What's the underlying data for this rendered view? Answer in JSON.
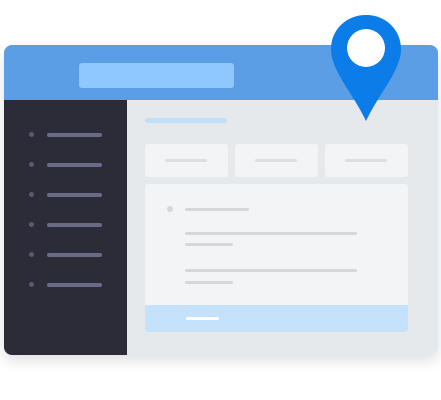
{
  "search": {
    "value": "",
    "placeholder": ""
  },
  "icons": {
    "search": "search-icon",
    "location_pin": "map-pin-icon"
  },
  "sidebar": {
    "items": [
      {
        "id": 1
      },
      {
        "id": 2
      },
      {
        "id": 3
      },
      {
        "id": 4
      },
      {
        "id": 5
      },
      {
        "id": 6
      }
    ]
  },
  "colors": {
    "header": "#5b9ee6",
    "sidebar": "#2b2c38",
    "main": "#e6e9ec",
    "pin": "#0b7ce8",
    "accent_light": "#c5e2fc"
  }
}
